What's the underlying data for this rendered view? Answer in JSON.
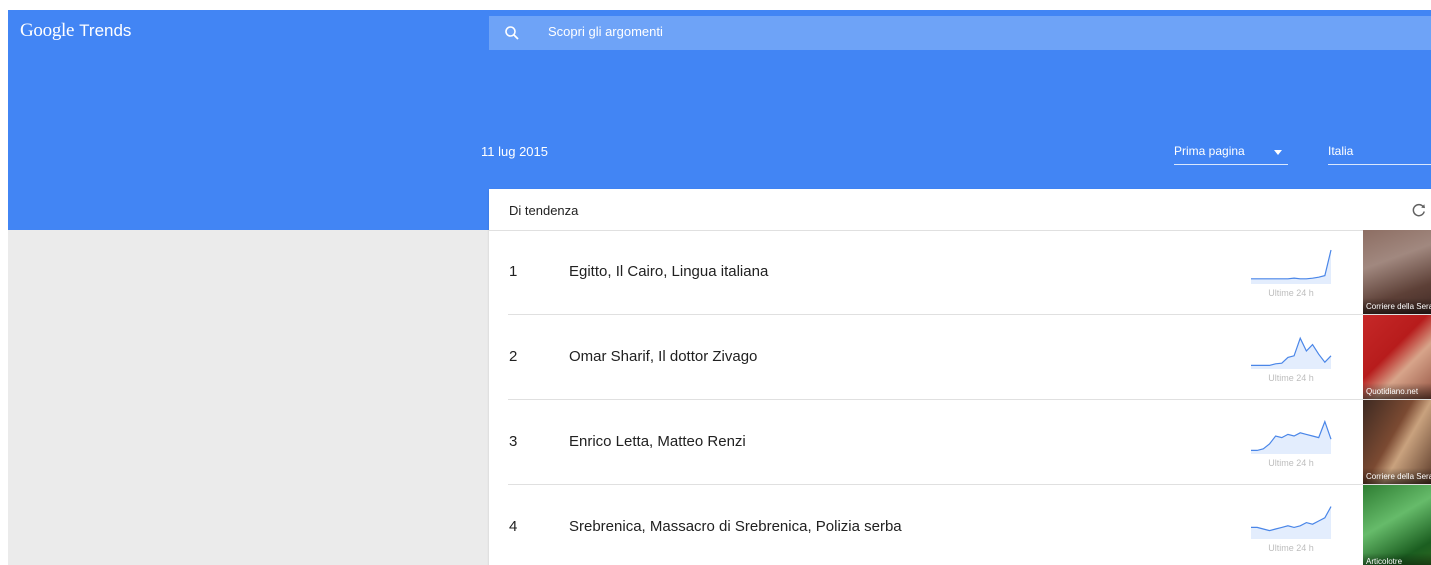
{
  "app": {
    "logo_google": "Google",
    "logo_trends": "Trends"
  },
  "search": {
    "placeholder": "Scopri gli argomenti",
    "icon": "search-icon"
  },
  "date": "11 lug 2015",
  "filters": {
    "category": "Prima pagina",
    "country": "Italia"
  },
  "panel": {
    "title": "Di tendenza",
    "refresh_icon": "refresh-icon"
  },
  "colors": {
    "header": "#4285f4",
    "search_bar": "#6ea3f7",
    "sparkline": "#4a86e8",
    "background": "#ebebeb"
  },
  "trends": [
    {
      "rank": "1",
      "title": "Egitto, Il Cairo, Lingua italiana",
      "spark_label": "Ultime 24 h",
      "source": "Corriere della Sera",
      "spark": [
        0.1,
        0.1,
        0.1,
        0.1,
        0.1,
        0.1,
        0.1,
        0.12,
        0.1,
        0.1,
        0.12,
        0.15,
        0.2,
        1.0
      ]
    },
    {
      "rank": "2",
      "title": "Omar Sharif, Il dottor Zivago",
      "spark_label": "Ultime 24 h",
      "source": "Quotidiano.net",
      "spark": [
        0.05,
        0.05,
        0.05,
        0.05,
        0.1,
        0.12,
        0.3,
        0.35,
        0.9,
        0.5,
        0.7,
        0.4,
        0.15,
        0.35
      ]
    },
    {
      "rank": "3",
      "title": "Enrico Letta, Matteo Renzi",
      "spark_label": "Ultime 24 h",
      "source": "Corriere della Sera",
      "spark": [
        0.05,
        0.05,
        0.1,
        0.25,
        0.5,
        0.45,
        0.55,
        0.5,
        0.6,
        0.55,
        0.5,
        0.45,
        0.95,
        0.4
      ]
    },
    {
      "rank": "4",
      "title": "Srebrenica, Massacro di Srebrenica, Polizia serba",
      "spark_label": "Ultime 24 h",
      "source": "Articolotre",
      "spark": [
        0.3,
        0.3,
        0.25,
        0.2,
        0.25,
        0.3,
        0.35,
        0.3,
        0.35,
        0.45,
        0.4,
        0.5,
        0.6,
        0.95
      ]
    }
  ]
}
